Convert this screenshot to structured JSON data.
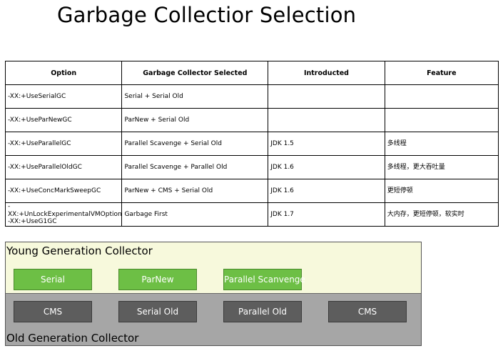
{
  "title": "Garbage Collectior Selection",
  "table": {
    "headers": [
      "Option",
      "Garbage Collector Selected",
      "Introducted",
      "Feature"
    ],
    "rows": [
      {
        "option": [
          "-XX:+UseSerialGC"
        ],
        "collector": "Serial + Serial Old",
        "introduced": "",
        "feature": ""
      },
      {
        "option": [
          "-XX:+UseParNewGC"
        ],
        "collector": "ParNew + Serial Old",
        "introduced": "",
        "feature": ""
      },
      {
        "option": [
          "-XX:+UseParallelGC"
        ],
        "collector": "Parallel Scavenge + Serial Old",
        "introduced": "JDK 1.5",
        "feature": "多线程"
      },
      {
        "option": [
          "-XX:+UseParallelOldGC"
        ],
        "collector": "Parallel Scavenge + Parallel Old",
        "introduced": "JDK 1.6",
        "feature": "多线程，更大吞吐量"
      },
      {
        "option": [
          "-XX:+UseConcMarkSweepGC"
        ],
        "collector": "ParNew + CMS + Serial Old",
        "introduced": "JDK 1.6",
        "feature": "更短停顿"
      },
      {
        "option": [
          "-XX:+UnLockExperimentalVMOption",
          "-XX:+UseG1GC"
        ],
        "collector": "Garbage First",
        "introduced": "JDK 1.7",
        "feature": "大内存，更短停顿，软实时"
      }
    ]
  },
  "young": {
    "label": "Young Generation Collector",
    "collectors": [
      "Serial",
      "ParNew",
      "Parallel Scanvenge"
    ]
  },
  "old": {
    "label": "Old Generation Collector",
    "collectors": [
      "CMS",
      "Serial Old",
      "Parallel Old",
      "CMS"
    ]
  },
  "colors": {
    "young_bg": "#f7f9dc",
    "old_bg": "#a6a6a6",
    "young_box": "#6dbf45",
    "old_box": "#5d5d5d"
  }
}
